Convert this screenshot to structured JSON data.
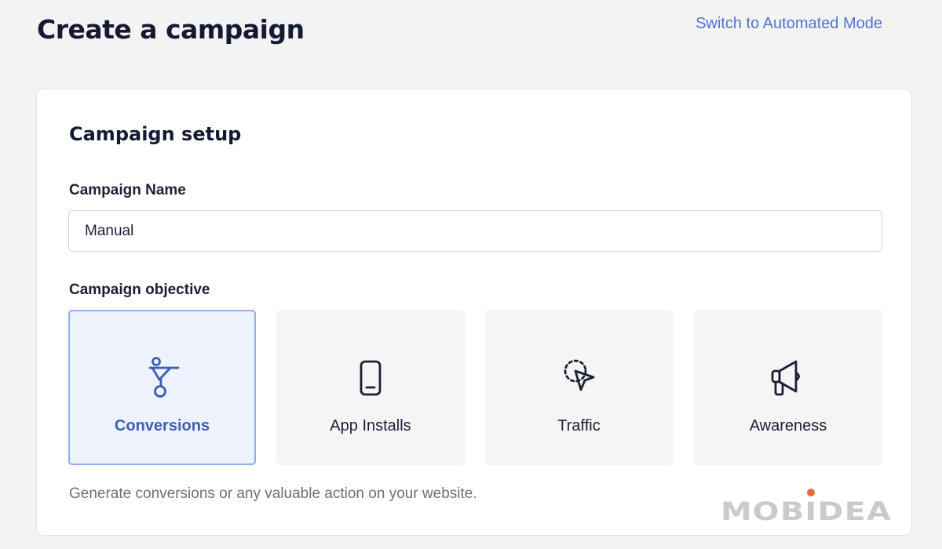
{
  "header": {
    "title": "Create a campaign",
    "mode_link": "Switch to Automated Mode"
  },
  "setup": {
    "title": "Campaign setup",
    "name_label": "Campaign Name",
    "name_value": "Manual",
    "objective_label": "Campaign objective",
    "objectives": [
      {
        "label": "Conversions",
        "icon": "funnel-icon",
        "selected": true
      },
      {
        "label": "App Installs",
        "icon": "smartphone-icon",
        "selected": false
      },
      {
        "label": "Traffic",
        "icon": "cursor-click-icon",
        "selected": false
      },
      {
        "label": "Awareness",
        "icon": "megaphone-icon",
        "selected": false
      }
    ],
    "objective_description": "Generate conversions or any valuable action on your website."
  },
  "watermark": {
    "text": "MOBIDEA",
    "dot_color": "#e0703a"
  },
  "colors": {
    "accent": "#3b5fb9",
    "link": "#4f74d0",
    "selected_bg": "#edf2fd",
    "selected_border": "#8fb0e6"
  }
}
